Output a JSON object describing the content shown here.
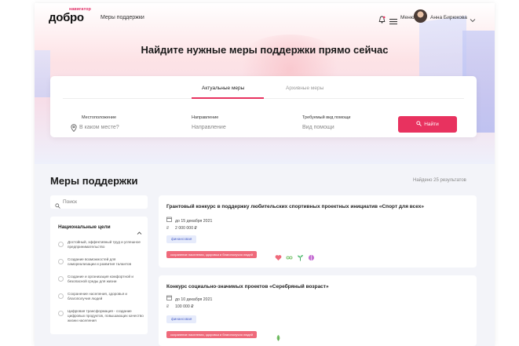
{
  "header": {
    "logo_text": "добро",
    "logo_sup": "навигатор",
    "nav_link": "Меры поддержки",
    "menu_label": "Меню",
    "user_name": "Анна Бирюкова"
  },
  "hero": {
    "title": "Найдите нужные меры поддержки прямо сейчас"
  },
  "search": {
    "tabs": [
      {
        "label": "Актуальные меры",
        "active": true
      },
      {
        "label": "Архивные меры",
        "active": false
      }
    ],
    "fields": [
      {
        "label": "Местоположение",
        "placeholder": "В каком месте?"
      },
      {
        "label": "Направление",
        "placeholder": "Направление"
      },
      {
        "label": "Требуемый вид помощи",
        "placeholder": "Вид помощи"
      }
    ],
    "button_label": "Найти"
  },
  "content": {
    "section_title": "Меры поддержки",
    "results_text": "Найдено 25 результатов"
  },
  "sidebar": {
    "search_placeholder": "Поиск",
    "filter_title": "Национальные цели",
    "goals": [
      "Достойный, эффективный труд и успешное предпринимательство",
      "Создание возможностей для самореализации и развития талантов",
      "Создание и организация комфортной и безопасной среды для жизни",
      "Сохранение населения, здоровья и благополучия людей",
      "Цифровая трансформация - создание цифровых продуктов, повышающих качество жизни населения"
    ]
  },
  "cards": [
    {
      "title": "Грантовый конкурс в поддержку любительских спортивных проектных инициатив «Спорт для всех»",
      "date": "до 15 декабря 2021",
      "amount": "2 000 000 ₽",
      "type": "финансовая",
      "goal_tag": "сохранение населения, здоровья и благополучия людей",
      "icons": [
        "heart-icon",
        "infinity-icon",
        "sprout-icon",
        "brain-icon"
      ]
    },
    {
      "title": "Конкурс социально-значимых проектов «Серебряный возраст»",
      "date": "до 10 декабря 2021",
      "amount": "100 000 ₽",
      "type": "финансовая",
      "goal_tag": "сохранение населения, здоровья и благополучия людей",
      "icons": [
        "leaf-icon"
      ]
    }
  ],
  "colors": {
    "accent": "#e8325f",
    "pill_bg": "#e6ebfb",
    "tag_bg": "#ef6a7b"
  }
}
